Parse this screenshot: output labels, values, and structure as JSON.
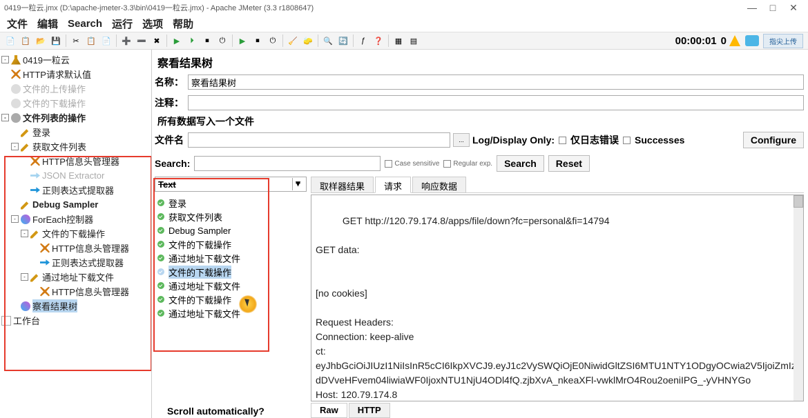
{
  "window": {
    "title": "0419一粒云.jmx (D:\\apache-jmeter-3.3\\bin\\0419一粒云.jmx) - Apache JMeter (3.3 r1808647)"
  },
  "menu": [
    "文件",
    "编辑",
    "Search",
    "运行",
    "选项",
    "帮助"
  ],
  "timer": "00:00:01",
  "errors": "0",
  "status_btn": "指尖上传",
  "tree": {
    "root": "0419一粒云",
    "n_http_default": "HTTP请求默认值",
    "n_upload": "文件的上传操作",
    "n_download": "文件的下载操作",
    "n_list": "文件列表的操作",
    "n_login": "登录",
    "n_getlist": "获取文件列表",
    "n_httphdr": "HTTP信息头管理器",
    "n_jsonext": "JSON Extractor",
    "n_regex": "正则表达式提取器",
    "n_debug": "Debug Sampler",
    "n_foreach": "ForEach控制器",
    "n_dl_op": "文件的下载操作",
    "n_httphdr2": "HTTP信息头管理器",
    "n_regex2": "正则表达式提取器",
    "n_dl_addr": "通过地址下载文件",
    "n_httphdr3": "HTTP信息头管理器",
    "n_results": "察看结果树",
    "n_workbench": "工作台"
  },
  "panel": {
    "title": "察看结果树",
    "name_label": "名称：",
    "name_value": "察看结果树",
    "comment_label": "注释：",
    "file_section": "所有数据写入一个文件",
    "file_label": "文件名",
    "log_only": "Log/Display Only:",
    "ck_errors": "仅日志错误",
    "ck_success": "Successes",
    "configure": "Configure",
    "search_label": "Search:",
    "ck_case": "Case sensitive",
    "ck_regex": "Regular exp.",
    "btn_search": "Search",
    "btn_reset": "Reset"
  },
  "drop": "Text",
  "results": [
    "登录",
    "获取文件列表",
    "Debug Sampler",
    "文件的下载操作",
    "通过地址下载文件",
    "文件的下载操作",
    "通过地址下载文件",
    "文件的下载操作",
    "通过地址下载文件"
  ],
  "tabs": [
    "取样器结果",
    "请求",
    "响应数据"
  ],
  "body_text": "GET http://120.79.174.8/apps/file/down?fc=personal&fi=14794\n\nGET data:\n\n\n[no cookies]\n\nRequest Headers:\nConnection: keep-alive\nct:\neyJhbGciOiJIUzI1NiIsInR5cCI6IkpXVCJ9.eyJ1c2VySWQiOjE0NiwidGltZSI6MTU1NTY1ODgyOCwia2V5IjoiZmIzdDVveHFvem04liwiaWF0IjoxNTU1NjU4ODl4fQ.zjbXvA_nkeaXFl-vwklMrO4Rou2oeniIPG_-yVHNYGo\nHost: 120.79.174.8",
  "bottom_tabs": [
    "Raw",
    "HTTP"
  ],
  "scroll_auto": "Scroll automatically?"
}
